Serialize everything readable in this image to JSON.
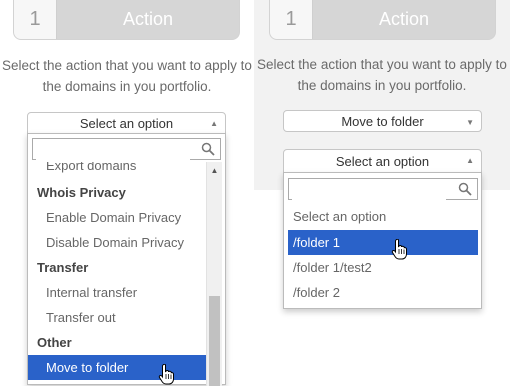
{
  "left": {
    "step": {
      "number": "1",
      "title": "Action"
    },
    "instructions": "Select the action that you want to apply to the domains in you portfolio.",
    "select": {
      "placeholder": "Select an option"
    },
    "search": {
      "value": ""
    },
    "options": [
      {
        "label": "Export domains",
        "type": "item"
      },
      {
        "label": "Whois Privacy",
        "type": "group"
      },
      {
        "label": "Enable Domain Privacy",
        "type": "item"
      },
      {
        "label": "Disable Domain Privacy",
        "type": "item"
      },
      {
        "label": "Transfer",
        "type": "group"
      },
      {
        "label": "Internal transfer",
        "type": "item"
      },
      {
        "label": "Transfer out",
        "type": "item"
      },
      {
        "label": "Other",
        "type": "group"
      },
      {
        "label": "Move to folder",
        "type": "item",
        "selected": true
      }
    ]
  },
  "right": {
    "step": {
      "number": "1",
      "title": "Action"
    },
    "instructions": "Select the action that you want to apply to the domains in you portfolio.",
    "action_select": {
      "value": "Move to folder"
    },
    "folder_select": {
      "placeholder": "Select an option"
    },
    "search": {
      "value": ""
    },
    "options": [
      {
        "label": "Select an option",
        "type": "item"
      },
      {
        "label": "/folder 1",
        "type": "item",
        "selected": true
      },
      {
        "label": "/folder 1/test2",
        "type": "item"
      },
      {
        "label": "/folder 2",
        "type": "item"
      }
    ]
  },
  "colors": {
    "selected_bg": "#2a62c9",
    "header_bg": "#d6d6d6",
    "panel_bg": "#f2f2f2"
  },
  "icons": {
    "search": "search-icon",
    "dropdown_arrow": "triangle-up-icon",
    "cursor": "hand-pointer-icon"
  }
}
